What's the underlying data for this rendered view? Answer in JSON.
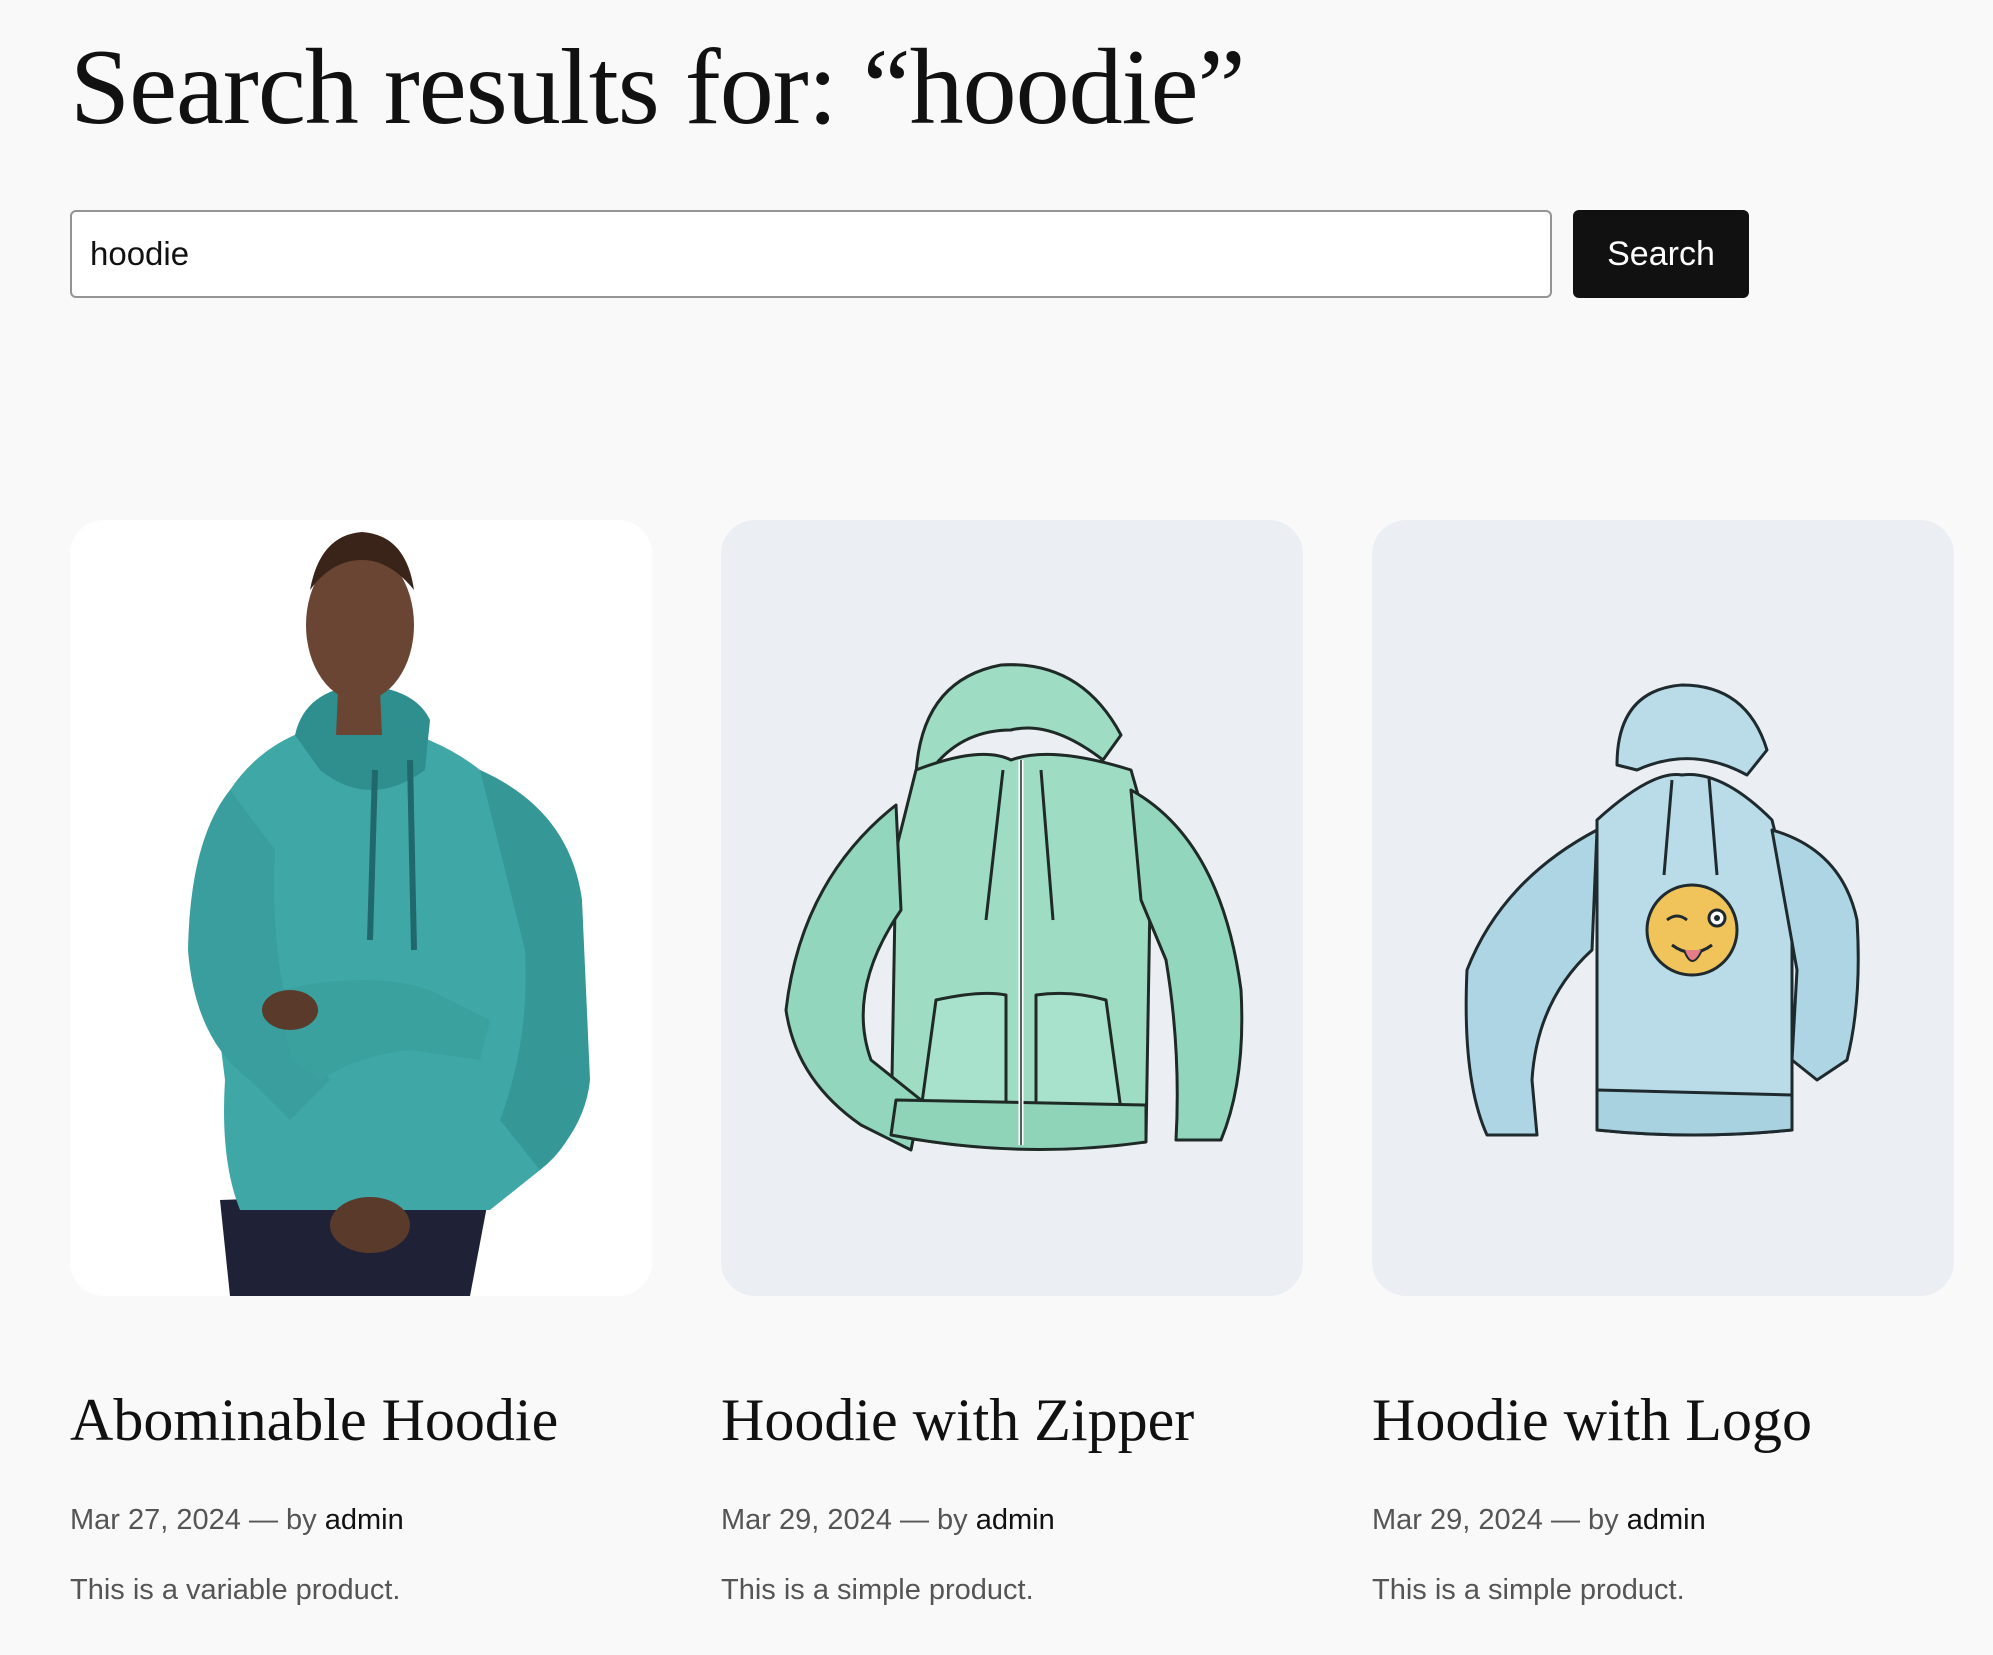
{
  "page": {
    "title": "Search results for: “hoodie”"
  },
  "search": {
    "value": "hoodie",
    "button_label": "Search"
  },
  "results": [
    {
      "title": "Abominable Hoodie",
      "date": "Mar 27, 2024",
      "separator": "—",
      "by": "by",
      "author": "admin",
      "excerpt": "This is a variable product.",
      "image_bg": "#ffffff",
      "image_icon": "model-wearing-teal-hoodie-photo"
    },
    {
      "title": "Hoodie with Zipper",
      "date": "Mar 29, 2024",
      "separator": "—",
      "by": "by",
      "author": "admin",
      "excerpt": "This is a simple product.",
      "image_bg": "#ebeff4",
      "image_icon": "mint-zip-hoodie-illustration"
    },
    {
      "title": "Hoodie with Logo",
      "date": "Mar 29, 2024",
      "separator": "—",
      "by": "by",
      "author": "admin",
      "excerpt": "This is a simple product.",
      "image_bg": "#ebeff4",
      "image_icon": "light-blue-hoodie-winking-emoji-illustration"
    }
  ],
  "colors": {
    "page_bg": "#f9f9f9",
    "button_bg": "#111111",
    "teal": "#3fa7a6",
    "mint": "#9edcc4",
    "light_blue": "#b9dce8"
  }
}
